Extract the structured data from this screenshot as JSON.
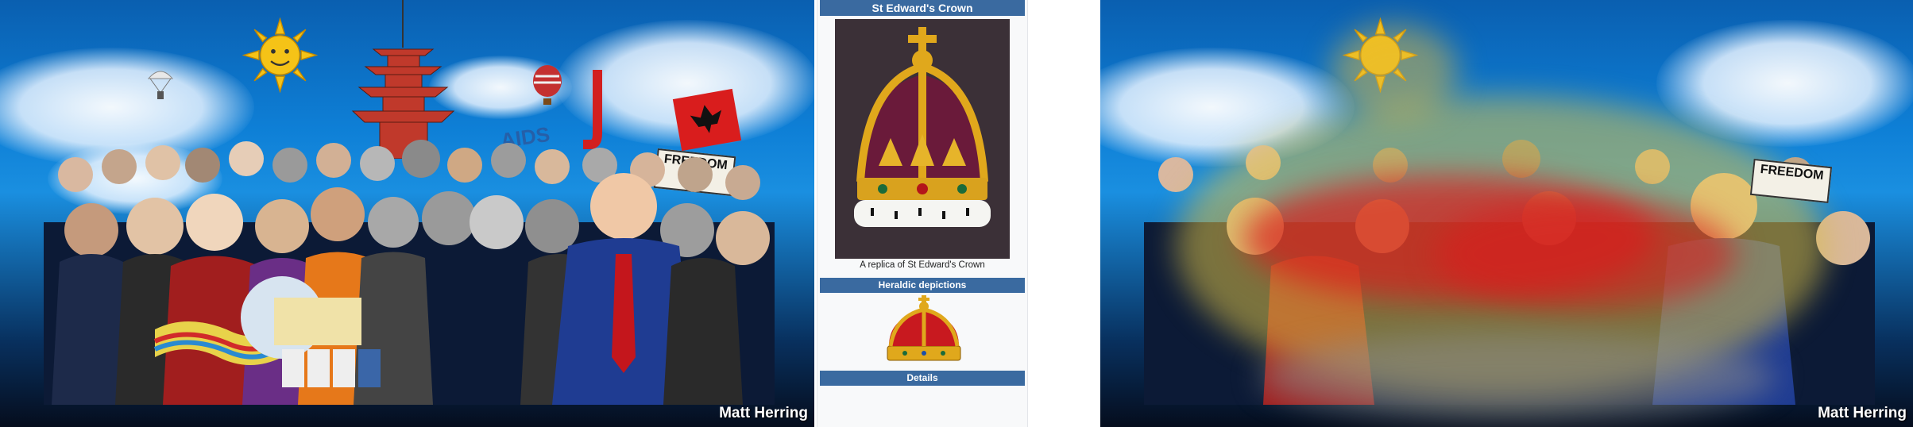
{
  "collage": {
    "signature": "Matt Herring",
    "aids_text": "AIDS",
    "freedom_text": "FREEDOM",
    "icons": [
      "sun-icon",
      "pagoda-icon",
      "parachute-icon",
      "hot-air-balloon-icon",
      "flag-icon"
    ],
    "colors": {
      "sky_top": "#0a5fb0",
      "sky_mid": "#1a8fe0",
      "ground": "#050d1d",
      "sun": "#f5c317"
    }
  },
  "infobox": {
    "title": "St Edward's Crown",
    "image_caption": "A replica of St Edward's Crown",
    "heraldic_header": "Heraldic depictions",
    "details_header": "Details",
    "colors": {
      "header_bg": "#3a6aa0",
      "panel_bg": "#f8f9fa",
      "crown_gold": "#e0a81c",
      "crown_velvet": "#6a1a3a",
      "ermine": "#f5f5f2"
    }
  },
  "collage_overlay": {
    "signature": "Matt Herring",
    "freedom_text": "FREEDOM",
    "heatmap_colors": {
      "hot": "#d81c1c",
      "warm": "#e3b93a",
      "cool": "#b8b05a"
    }
  }
}
